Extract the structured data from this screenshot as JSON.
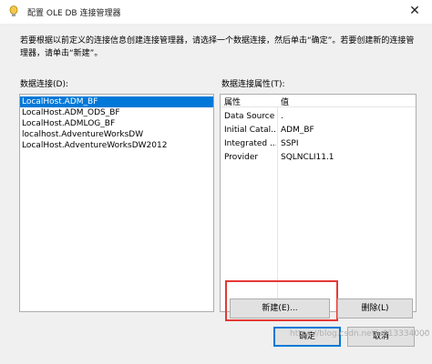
{
  "window": {
    "title": "配置 OLE DB 连接管理器",
    "close_glyph": "✕"
  },
  "instructions": "若要根据以前定义的连接信息创建连接管理器，请选择一个数据连接，然后单击“确定”。若要创建新的连接管理器，请单击“新建”。",
  "connections": {
    "label": "数据连接(D):",
    "items": [
      "LocalHost.ADM_BF",
      "LocalHost.ADM_ODS_BF",
      "LocalHost.ADMLOG_BF",
      "localhost.AdventureWorksDW",
      "LocalHost.AdventureWorksDW2012"
    ],
    "selected_index": 0
  },
  "properties": {
    "label": "数据连接属性(T):",
    "header_key": "属性",
    "header_value": "值",
    "rows": [
      {
        "key": "Data Source",
        "value": "."
      },
      {
        "key": "Initial Catal...",
        "value": "ADM_BF"
      },
      {
        "key": "Integrated ...",
        "value": "SSPI"
      },
      {
        "key": "Provider",
        "value": "SQLNCLI11.1"
      }
    ]
  },
  "buttons": {
    "new_label": "新建(E)...",
    "delete_label": "删除(L)",
    "ok_label": "确定",
    "cancel_label": "取消"
  },
  "watermark": "https://blog.csdn.net/u013334000",
  "colors": {
    "selection": "#0078d7",
    "highlight_box": "#e53935"
  }
}
